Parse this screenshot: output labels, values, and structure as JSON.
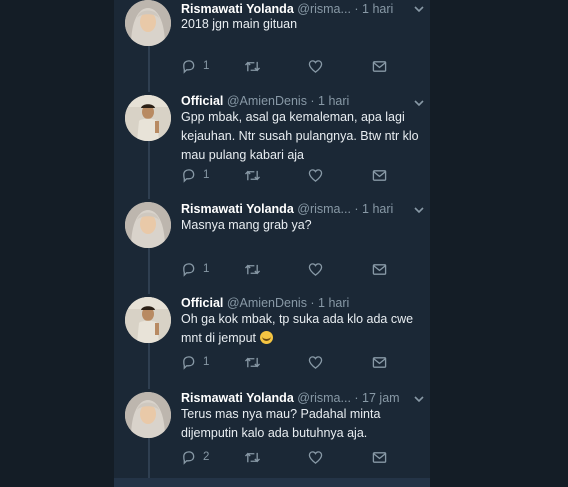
{
  "tweets": [
    {
      "name": "Rismawati Yolanda",
      "handle": "@risma...",
      "time": "· 1 hari",
      "text": "2018 jgn main gituan",
      "reply_count": "1",
      "avatar": "hijab-woman"
    },
    {
      "name": "Official",
      "handle": "@AmienDenis",
      "time": "· 1 hari",
      "text": "Gpp mbak, asal ga kemaleman, apa lagi kejauhan. Ntr susah pulangnya. Btw ntr klo mau pulang kabari aja",
      "reply_count": "1",
      "avatar": "man"
    },
    {
      "name": "Rismawati Yolanda",
      "handle": "@risma...",
      "time": "· 1 hari",
      "text": "Masnya mang grab ya?",
      "reply_count": "1",
      "avatar": "hijab-woman"
    },
    {
      "name": "Official",
      "handle": "@AmienDenis",
      "time": "· 1 hari",
      "text": "Oh ga kok mbak, tp suka ada klo ada cwe mnt di jemput",
      "emoji": "grinning-sweat-emoji",
      "reply_count": "1",
      "avatar": "man"
    },
    {
      "name": "Rismawati Yolanda",
      "handle": "@risma...",
      "time": "· 17 jam",
      "text": "Terus mas nya mau? Padahal minta dijemputin kalo ada butuhnya aja.",
      "reply_count": "2",
      "avatar": "hijab-woman"
    }
  ],
  "icons": [
    "reply-icon",
    "retweet-icon",
    "like-icon",
    "dm-icon",
    "chevron-down-icon"
  ],
  "colors": {
    "background": "#141d26",
    "panel": "#1b2836",
    "text": "#e8edf1",
    "muted": "#8899a6"
  }
}
